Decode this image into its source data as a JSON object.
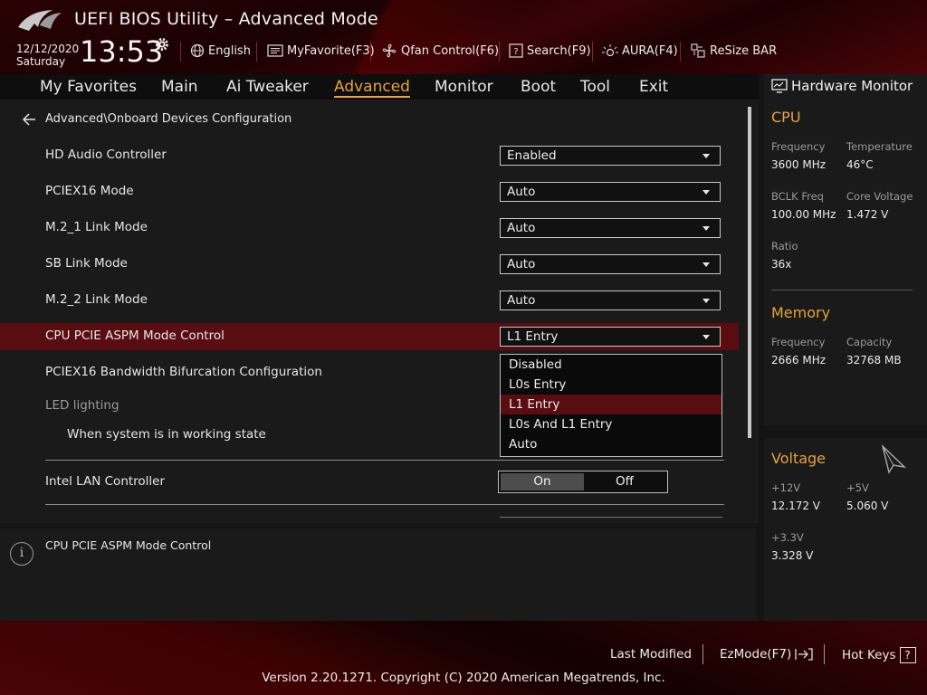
{
  "header": {
    "title": "UEFI BIOS Utility – Advanced Mode",
    "date": "12/12/2020",
    "day": "Saturday",
    "time": "13:53",
    "toolbar": [
      {
        "label": "English",
        "icon": "globe-icon"
      },
      {
        "label": "MyFavorite(F3)",
        "icon": "favorite-icon"
      },
      {
        "label": "Qfan Control(F6)",
        "icon": "fan-icon"
      },
      {
        "label": "Search(F9)",
        "icon": "search-icon"
      },
      {
        "label": "AURA(F4)",
        "icon": "aura-icon"
      },
      {
        "label": "ReSize BAR",
        "icon": "resize-bar-icon"
      }
    ]
  },
  "nav": {
    "tabs": [
      "My Favorites",
      "Main",
      "Ai Tweaker",
      "Advanced",
      "Monitor",
      "Boot",
      "Tool",
      "Exit"
    ],
    "active": "Advanced"
  },
  "main": {
    "breadcrumb": "Advanced\\Onboard Devices Configuration",
    "settings": [
      {
        "label": "HD Audio Controller",
        "value": "Enabled"
      },
      {
        "label": "PCIEX16 Mode",
        "value": "Auto"
      },
      {
        "label": "M.2_1 Link Mode",
        "value": "Auto"
      },
      {
        "label": "SB Link Mode",
        "value": "Auto"
      },
      {
        "label": "M.2_2 Link Mode",
        "value": "Auto"
      },
      {
        "label": "CPU PCIE ASPM Mode Control",
        "value": "L1 Entry"
      },
      {
        "label": "PCIEX16 Bandwidth Bifurcation Configuration"
      }
    ],
    "led_section": "LED lighting",
    "led_sub": "When system is in working state",
    "dropdown_options": [
      "Disabled",
      "L0s Entry",
      "L1 Entry",
      "L0s And L1 Entry",
      "Auto"
    ],
    "dropdown_selected": "L1 Entry",
    "lan": {
      "label": "Intel LAN Controller",
      "on": "On",
      "off": "Off",
      "state": "On"
    }
  },
  "help": {
    "icon": "info-icon",
    "text": "CPU PCIE ASPM Mode Control"
  },
  "hwmon": {
    "title": "Hardware Monitor",
    "cpu": {
      "heading": "CPU",
      "frequency_label": "Frequency",
      "frequency": "3600 MHz",
      "temperature_label": "Temperature",
      "temperature": "46°C",
      "bclk_label": "BCLK Freq",
      "bclk": "100.00 MHz",
      "core_voltage_label": "Core Voltage",
      "core_voltage": "1.472 V",
      "ratio_label": "Ratio",
      "ratio": "36x"
    },
    "memory": {
      "heading": "Memory",
      "frequency_label": "Frequency",
      "frequency": "2666 MHz",
      "capacity_label": "Capacity",
      "capacity": "32768 MB"
    },
    "voltage": {
      "heading": "Voltage",
      "v12_label": "+12V",
      "v12": "12.172 V",
      "v5_label": "+5V",
      "v5": "5.060 V",
      "v33_label": "+3.3V",
      "v33": "3.328 V"
    }
  },
  "footer": {
    "last_modified": "Last Modified",
    "ezmode": "EzMode(F7)",
    "hotkeys": "Hot Keys",
    "hotkeys_key": "?",
    "copyright": "Version 2.20.1271. Copyright (C) 2020 American Megatrends, Inc."
  },
  "colors": {
    "accent": "#e8a23a",
    "highlight": "#5a0d10",
    "panel": "#1a1a1a"
  }
}
